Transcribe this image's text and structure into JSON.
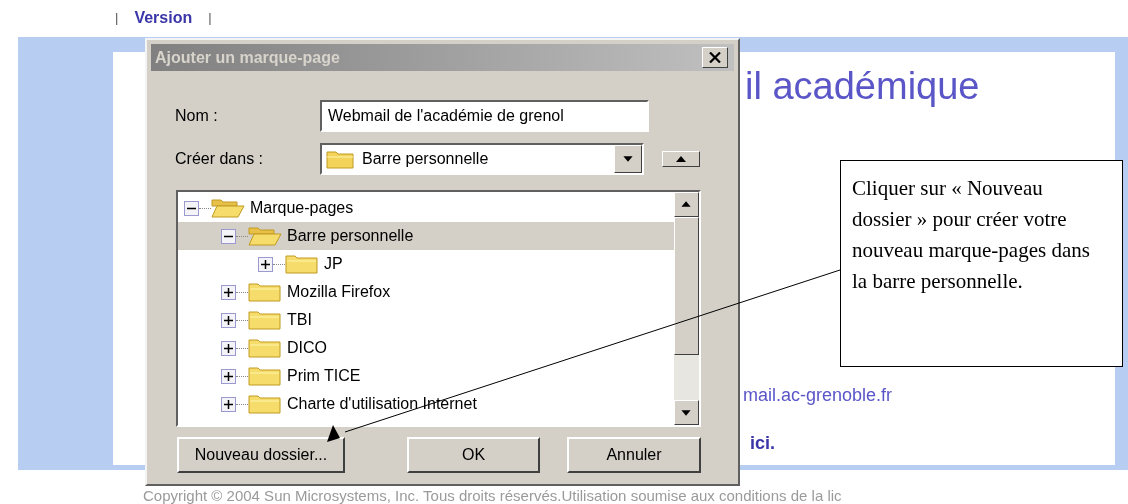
{
  "page": {
    "nav": [
      {
        "text": "|",
        "kind": "separator"
      },
      {
        "text": "Version",
        "kind": "link"
      },
      {
        "text": "|",
        "kind": "separator"
      }
    ],
    "heading": "il académique",
    "link": "mail.ac-grenoble.fr",
    "link_2": "ici.",
    "footer": "Copyright © 2004 Sun Microsystems, Inc. Tous droits réservés.Utilisation soumise aux conditions de la lic"
  },
  "dialog": {
    "title": "Ajouter un marque-page",
    "name_label": "Nom :",
    "name_value": "Webmail de l'académie de grenol",
    "folder_label": "Créer dans :",
    "folder_value": "Barre personnelle",
    "tree": [
      {
        "label": "Marque-pages",
        "expanded": true,
        "selected": false,
        "children": [
          {
            "label": "Barre personnelle",
            "expanded": true,
            "selected": true,
            "children": [
              {
                "label": "JP",
                "expanded": false,
                "selected": false
              }
            ]
          },
          {
            "label": "Mozilla Firefox",
            "expanded": false,
            "selected": false
          },
          {
            "label": "TBI",
            "expanded": false,
            "selected": false
          },
          {
            "label": "DICO",
            "expanded": false,
            "selected": false
          },
          {
            "label": "Prim TICE",
            "expanded": false,
            "selected": false
          },
          {
            "label": "Charte d'utilisation Internet",
            "expanded": false,
            "selected": false
          }
        ]
      }
    ],
    "buttons": [
      "Nouveau dossier...",
      "OK",
      "Annuler"
    ]
  },
  "callout": {
    "text": "Cliquer sur « Nouveau dossier » pour créer votre nouveau marque-pages dans la barre personnelle."
  }
}
